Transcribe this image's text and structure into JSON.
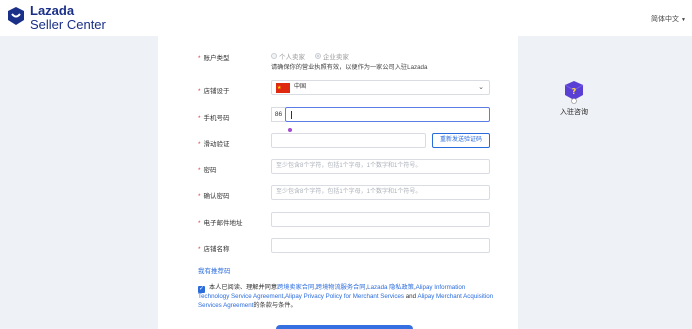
{
  "header": {
    "logo_line1": "Lazada",
    "logo_line2": "Seller Center",
    "language": "简体中文",
    "language_caret": "▼",
    "brand_color": "#1a2f87"
  },
  "form": {
    "account_type": {
      "label": "账户类型",
      "options": [
        "个人卖家",
        "企业卖家"
      ],
      "selected": "企业卖家",
      "hint": "请确保你的营业执照有效，以便作为一家公司入驻Lazada"
    },
    "store_location": {
      "label": "店铺设于",
      "value": "中国",
      "icon": "china-flag-icon"
    },
    "phone": {
      "label": "手机号码",
      "prefix": "86",
      "value": ""
    },
    "captcha": {
      "label": "滑动验证",
      "value": "",
      "button_label": "重新发送验证码"
    },
    "password": {
      "label": "密码",
      "placeholder": "至少包含8个字符，包括1个字母，1个数字和1个符号。"
    },
    "confirm_password": {
      "label": "确认密码",
      "placeholder": "至少包含8个字符，包括1个字母，1个数字和1个符号。"
    },
    "email": {
      "label": "电子邮件地址",
      "value": ""
    },
    "store_name": {
      "label": "店铺名称",
      "value": ""
    },
    "referrer_link": "我有推荐码",
    "agreement": {
      "checked": true,
      "prefix": "本人已阅读、理解并同意",
      "link1": "跨境卖家合同",
      "sep1": ",",
      "link2": "跨境物流服务合同",
      "sep2": ",",
      "link3": "Lazada 隐私政策",
      "sep3": ",",
      "link4": "Alipay Information Technology Service Agreement",
      "sep4": ",",
      "link5": "Alipay Privacy Policy for Merchant Services",
      "and_text": " and ",
      "link6": "Alipay Merchant Acquisition Services Agreement",
      "suffix": "的条款与条件。"
    }
  },
  "help": {
    "label": "入驻咨询",
    "icon": "help-chat-icon"
  },
  "colors": {
    "accent": "#2b6cdd",
    "required": "#e2373f",
    "background": "#eef1f6"
  }
}
